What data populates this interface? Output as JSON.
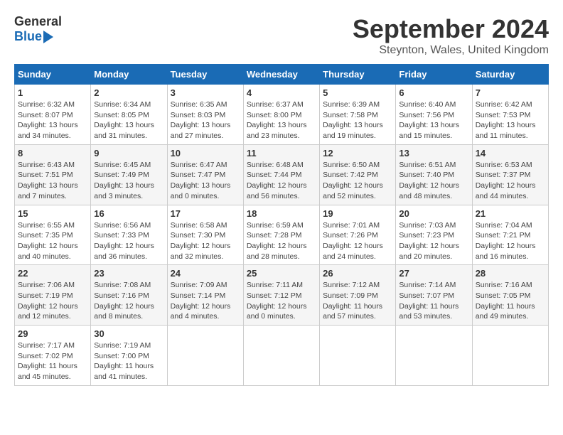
{
  "header": {
    "logo_general": "General",
    "logo_blue": "Blue",
    "month_title": "September 2024",
    "location": "Steynton, Wales, United Kingdom"
  },
  "weekdays": [
    "Sunday",
    "Monday",
    "Tuesday",
    "Wednesday",
    "Thursday",
    "Friday",
    "Saturday"
  ],
  "weeks": [
    [
      {
        "day": "1",
        "info": "Sunrise: 6:32 AM\nSunset: 8:07 PM\nDaylight: 13 hours\nand 34 minutes."
      },
      {
        "day": "2",
        "info": "Sunrise: 6:34 AM\nSunset: 8:05 PM\nDaylight: 13 hours\nand 31 minutes."
      },
      {
        "day": "3",
        "info": "Sunrise: 6:35 AM\nSunset: 8:03 PM\nDaylight: 13 hours\nand 27 minutes."
      },
      {
        "day": "4",
        "info": "Sunrise: 6:37 AM\nSunset: 8:00 PM\nDaylight: 13 hours\nand 23 minutes."
      },
      {
        "day": "5",
        "info": "Sunrise: 6:39 AM\nSunset: 7:58 PM\nDaylight: 13 hours\nand 19 minutes."
      },
      {
        "day": "6",
        "info": "Sunrise: 6:40 AM\nSunset: 7:56 PM\nDaylight: 13 hours\nand 15 minutes."
      },
      {
        "day": "7",
        "info": "Sunrise: 6:42 AM\nSunset: 7:53 PM\nDaylight: 13 hours\nand 11 minutes."
      }
    ],
    [
      {
        "day": "8",
        "info": "Sunrise: 6:43 AM\nSunset: 7:51 PM\nDaylight: 13 hours\nand 7 minutes."
      },
      {
        "day": "9",
        "info": "Sunrise: 6:45 AM\nSunset: 7:49 PM\nDaylight: 13 hours\nand 3 minutes."
      },
      {
        "day": "10",
        "info": "Sunrise: 6:47 AM\nSunset: 7:47 PM\nDaylight: 13 hours\nand 0 minutes."
      },
      {
        "day": "11",
        "info": "Sunrise: 6:48 AM\nSunset: 7:44 PM\nDaylight: 12 hours\nand 56 minutes."
      },
      {
        "day": "12",
        "info": "Sunrise: 6:50 AM\nSunset: 7:42 PM\nDaylight: 12 hours\nand 52 minutes."
      },
      {
        "day": "13",
        "info": "Sunrise: 6:51 AM\nSunset: 7:40 PM\nDaylight: 12 hours\nand 48 minutes."
      },
      {
        "day": "14",
        "info": "Sunrise: 6:53 AM\nSunset: 7:37 PM\nDaylight: 12 hours\nand 44 minutes."
      }
    ],
    [
      {
        "day": "15",
        "info": "Sunrise: 6:55 AM\nSunset: 7:35 PM\nDaylight: 12 hours\nand 40 minutes."
      },
      {
        "day": "16",
        "info": "Sunrise: 6:56 AM\nSunset: 7:33 PM\nDaylight: 12 hours\nand 36 minutes."
      },
      {
        "day": "17",
        "info": "Sunrise: 6:58 AM\nSunset: 7:30 PM\nDaylight: 12 hours\nand 32 minutes."
      },
      {
        "day": "18",
        "info": "Sunrise: 6:59 AM\nSunset: 7:28 PM\nDaylight: 12 hours\nand 28 minutes."
      },
      {
        "day": "19",
        "info": "Sunrise: 7:01 AM\nSunset: 7:26 PM\nDaylight: 12 hours\nand 24 minutes."
      },
      {
        "day": "20",
        "info": "Sunrise: 7:03 AM\nSunset: 7:23 PM\nDaylight: 12 hours\nand 20 minutes."
      },
      {
        "day": "21",
        "info": "Sunrise: 7:04 AM\nSunset: 7:21 PM\nDaylight: 12 hours\nand 16 minutes."
      }
    ],
    [
      {
        "day": "22",
        "info": "Sunrise: 7:06 AM\nSunset: 7:19 PM\nDaylight: 12 hours\nand 12 minutes."
      },
      {
        "day": "23",
        "info": "Sunrise: 7:08 AM\nSunset: 7:16 PM\nDaylight: 12 hours\nand 8 minutes."
      },
      {
        "day": "24",
        "info": "Sunrise: 7:09 AM\nSunset: 7:14 PM\nDaylight: 12 hours\nand 4 minutes."
      },
      {
        "day": "25",
        "info": "Sunrise: 7:11 AM\nSunset: 7:12 PM\nDaylight: 12 hours\nand 0 minutes."
      },
      {
        "day": "26",
        "info": "Sunrise: 7:12 AM\nSunset: 7:09 PM\nDaylight: 11 hours\nand 57 minutes."
      },
      {
        "day": "27",
        "info": "Sunrise: 7:14 AM\nSunset: 7:07 PM\nDaylight: 11 hours\nand 53 minutes."
      },
      {
        "day": "28",
        "info": "Sunrise: 7:16 AM\nSunset: 7:05 PM\nDaylight: 11 hours\nand 49 minutes."
      }
    ],
    [
      {
        "day": "29",
        "info": "Sunrise: 7:17 AM\nSunset: 7:02 PM\nDaylight: 11 hours\nand 45 minutes."
      },
      {
        "day": "30",
        "info": "Sunrise: 7:19 AM\nSunset: 7:00 PM\nDaylight: 11 hours\nand 41 minutes."
      },
      {
        "day": "",
        "info": ""
      },
      {
        "day": "",
        "info": ""
      },
      {
        "day": "",
        "info": ""
      },
      {
        "day": "",
        "info": ""
      },
      {
        "day": "",
        "info": ""
      }
    ]
  ]
}
